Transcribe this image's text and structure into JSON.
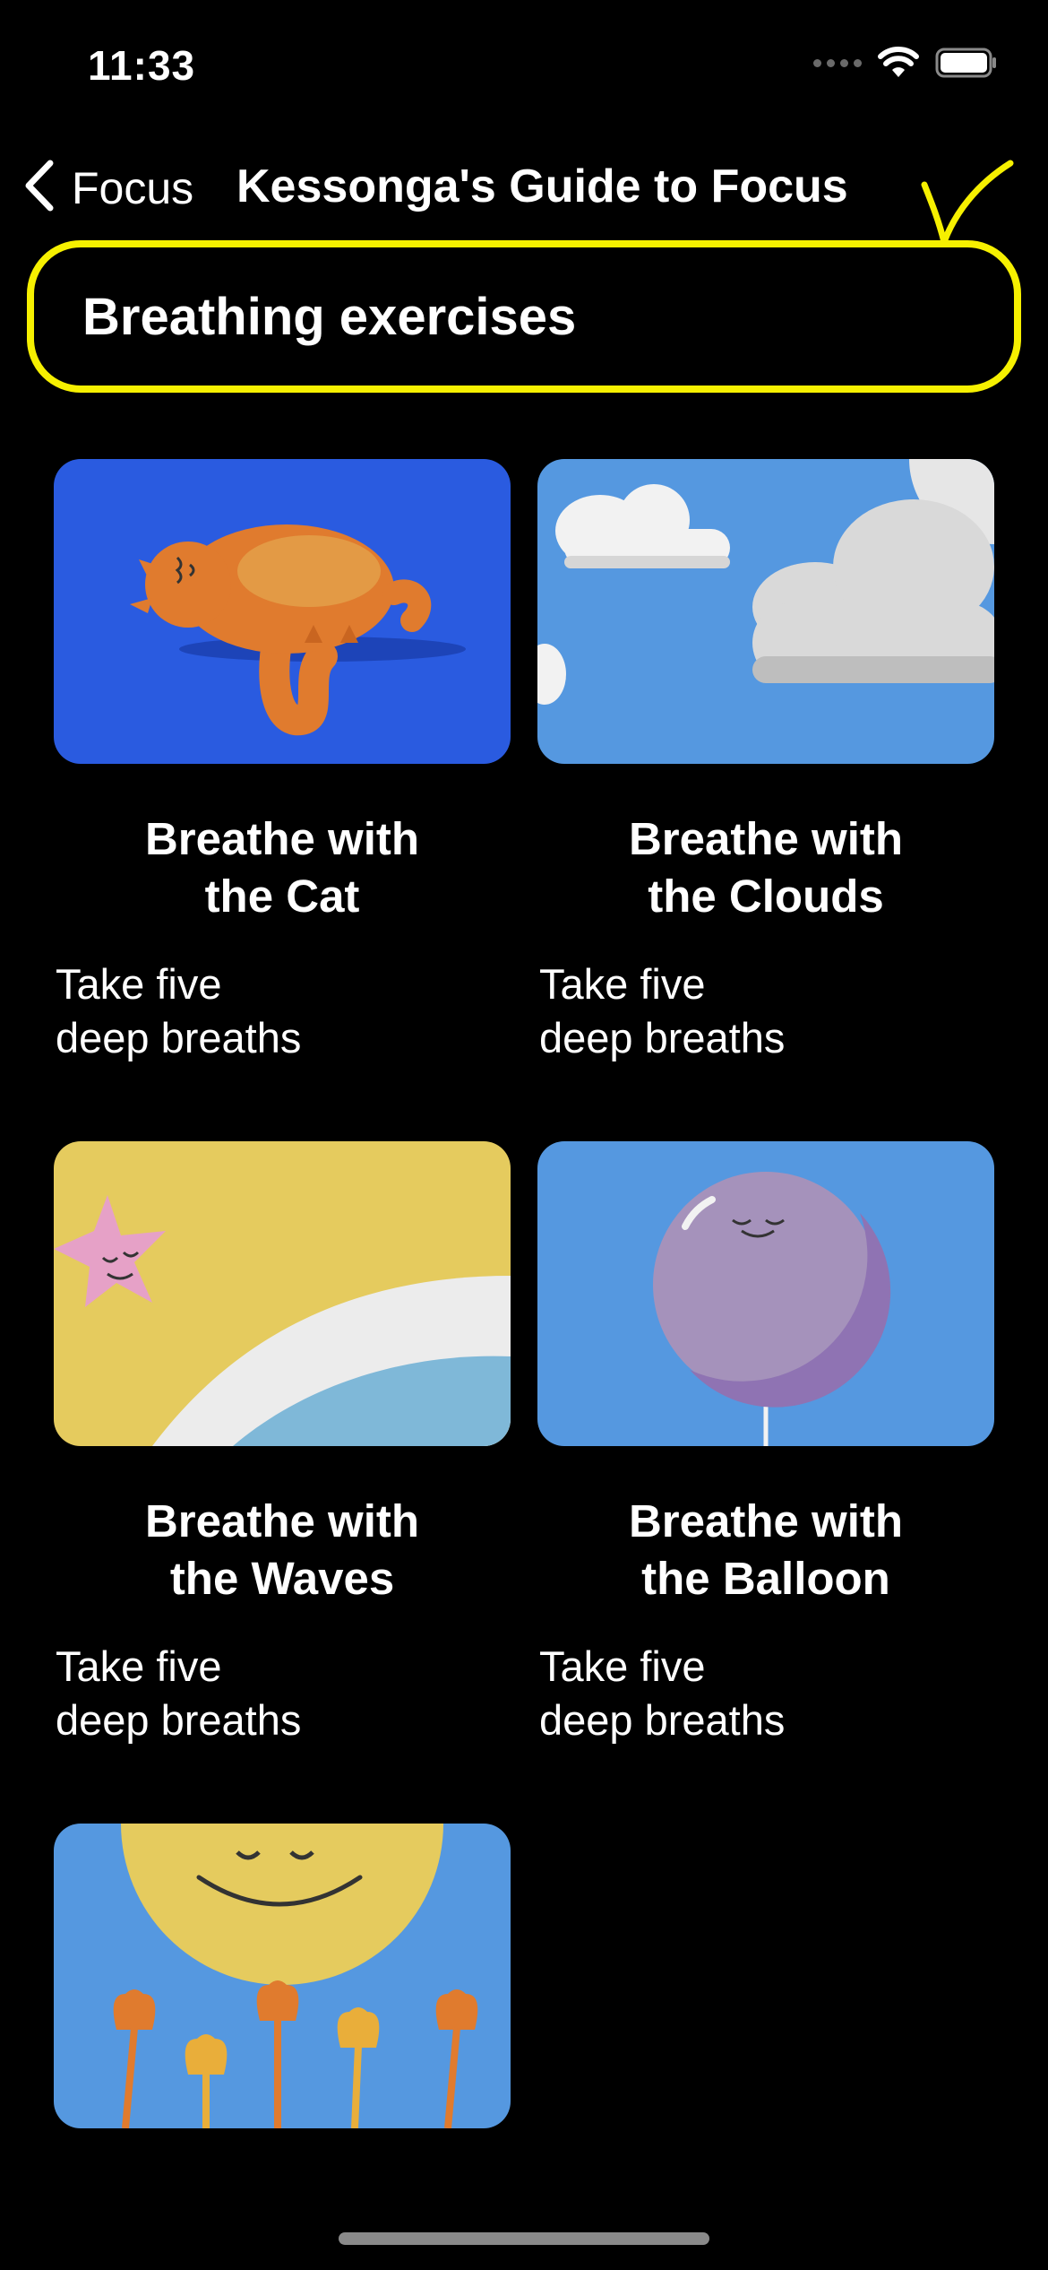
{
  "status_bar": {
    "time": "11:33",
    "icons": [
      "signal-dots-icon",
      "wifi-icon",
      "battery-icon"
    ]
  },
  "nav": {
    "back_label": "Focus",
    "title": "Kessonga's Guide to Focus"
  },
  "section": {
    "title": "Breathing exercises",
    "highlight_color": "#f6f000"
  },
  "cards": [
    {
      "title": "Breathe with\nthe Cat",
      "subtitle": "Take five\ndeep breaths",
      "image": "sleeping-cat-illustration"
    },
    {
      "title": "Breathe with\nthe Clouds",
      "subtitle": "Take five\ndeep breaths",
      "image": "clouds-illustration"
    },
    {
      "title": "Breathe with\nthe Waves",
      "subtitle": "Take five\ndeep breaths",
      "image": "starfish-waves-illustration"
    },
    {
      "title": "Breathe with\nthe Balloon",
      "subtitle": "Take five\ndeep breaths",
      "image": "balloon-illustration"
    },
    {
      "title": "",
      "subtitle": "",
      "image": "sun-flowers-illustration"
    }
  ],
  "colors": {
    "background": "#000000",
    "cat_card": "#2a5be0",
    "sky_card": "#5598e0",
    "waves_card": "#e5cb5e",
    "balloon": "#a592bb",
    "annotation": "#f6f000"
  }
}
